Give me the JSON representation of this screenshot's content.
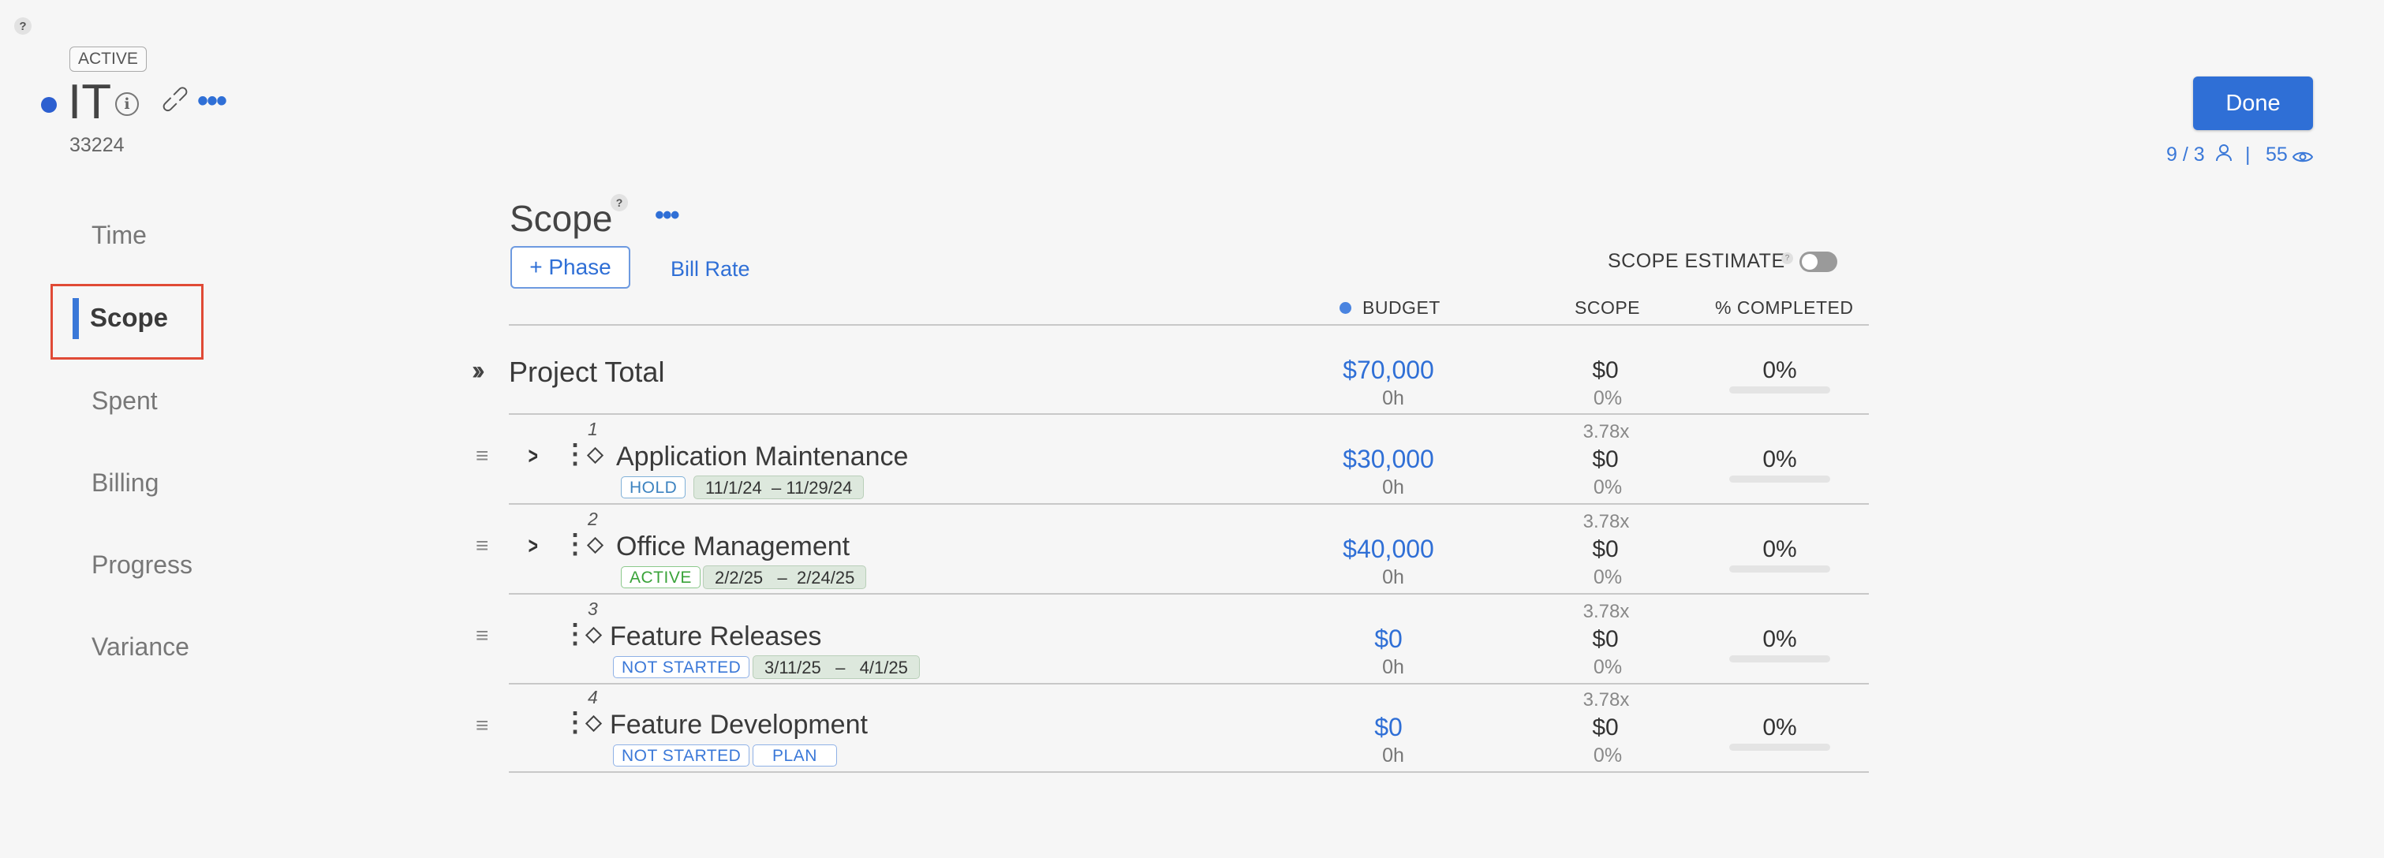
{
  "header": {
    "status": "ACTIVE",
    "project_title": "IT",
    "project_number": "33224",
    "done_label": "Done",
    "members_count": "9 / 3",
    "views_count": "55",
    "separator": "|"
  },
  "nav": {
    "items": [
      {
        "label": "Time"
      },
      {
        "label": "Scope"
      },
      {
        "label": "Spent"
      },
      {
        "label": "Billing"
      },
      {
        "label": "Progress"
      },
      {
        "label": "Variance"
      }
    ],
    "active": "Scope"
  },
  "scope": {
    "title": "Scope",
    "add_phase_label": "+ Phase",
    "bill_rate_label": "Bill Rate",
    "scope_estimate_label": "SCOPE ESTIMATE",
    "scope_estimate_on": false,
    "columns": {
      "budget": "BUDGET",
      "scope": "SCOPE",
      "completed": "% COMPLETED"
    },
    "total": {
      "label": "Project Total",
      "budget": "$70,000",
      "hours": "0h",
      "scope": "$0",
      "scope_pct": "0%",
      "completed": "0%",
      "progress": 0
    },
    "phases": [
      {
        "number": "1",
        "name": "Application Maintenance",
        "status": "HOLD",
        "dates": "11/1/24  – 11/29/24",
        "budget": "$30,000",
        "hours": "0h",
        "ratio": "3.78x",
        "scope": "$0",
        "scope_pct": "0%",
        "completed": "0%",
        "progress": 0
      },
      {
        "number": "2",
        "name": "Office Management",
        "status": "ACTIVE",
        "dates": "2/2/25   –  2/24/25",
        "budget": "$40,000",
        "hours": "0h",
        "ratio": "3.78x",
        "scope": "$0",
        "scope_pct": "0%",
        "completed": "0%",
        "progress": 0
      },
      {
        "number": "3",
        "name": "Feature Releases",
        "status": "NOT STARTED",
        "dates": "3/11/25   –   4/1/25",
        "budget": "$0",
        "hours": "0h",
        "ratio": "3.78x",
        "scope": "$0",
        "scope_pct": "0%",
        "completed": "0%",
        "progress": 0
      },
      {
        "number": "4",
        "name": "Feature Development",
        "status": "NOT STARTED",
        "plan_label": "PLAN",
        "budget": "$0",
        "hours": "0h",
        "ratio": "3.78x",
        "scope": "$0",
        "scope_pct": "0%",
        "completed": "0%",
        "progress": 0
      }
    ]
  },
  "icons": {
    "help": "question-icon",
    "info": "info-icon",
    "link": "link-icon",
    "more": "ellipsis-icon",
    "members": "person-icon",
    "views": "eye-icon",
    "expand_all": "double-chevron-right-icon",
    "drag": "drag-handle-icon",
    "expand": "chevron-right-icon",
    "kebab": "kebab-icon",
    "milestone": "diamond-icon"
  },
  "colors": {
    "accent": "#2f6fd6",
    "nav_highlight": "#e04a36",
    "project_dot": "#2c5fd0"
  }
}
